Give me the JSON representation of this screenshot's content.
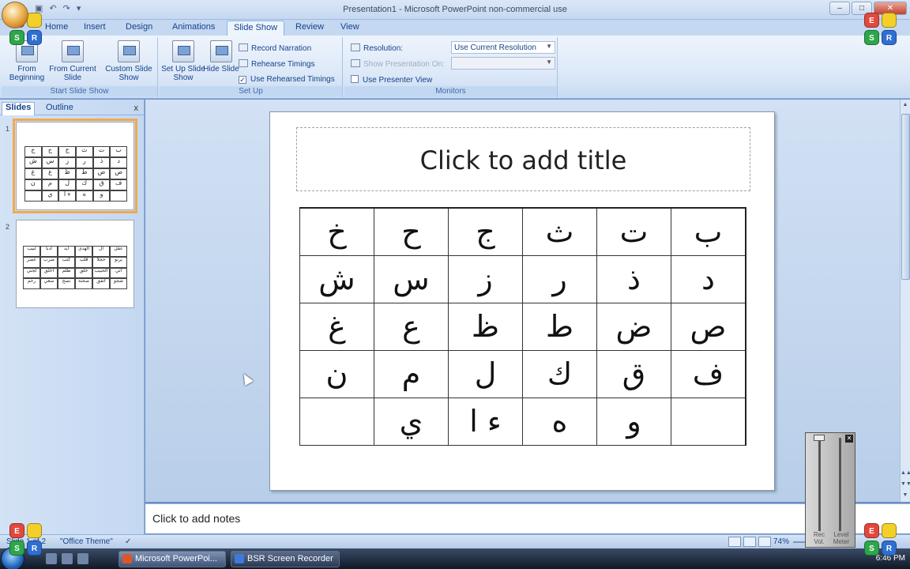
{
  "window": {
    "title": "Presentation1 - Microsoft PowerPoint non-commercial use",
    "controls": [
      "–",
      "□",
      "✕"
    ]
  },
  "tabs": [
    "Home",
    "Insert",
    "Design",
    "Animations",
    "Slide Show",
    "Review",
    "View"
  ],
  "ribbon": {
    "start": {
      "group_label": "Start Slide Show",
      "from_beginning": "From Beginning",
      "from_current": "From Current Slide",
      "custom": "Custom Slide Show"
    },
    "setup": {
      "group_label": "Set Up",
      "setup_show": "Set Up Slide Show",
      "hide_slide": "Hide Slide",
      "record": "Record Narration",
      "rehearse": "Rehearse Timings",
      "use_rehearsed": "Use Rehearsed Timings",
      "use_rehearsed_checked": true
    },
    "monitors": {
      "group_label": "Monitors",
      "resolution_label": "Resolution:",
      "resolution_value": "Use Current Resolution",
      "show_on_label": "Show Presentation On:",
      "presenter_view": "Use Presenter View"
    }
  },
  "left_pane": {
    "tab_slides": "Slides",
    "tab_outline": "Outline",
    "close": "x",
    "thumb1_num": "1",
    "thumb2_num": "2"
  },
  "slide": {
    "title_placeholder": "Click to add title",
    "arabic_letters": [
      "ب",
      "ت",
      "ث",
      "ج",
      "ح",
      "خ",
      "د",
      "ذ",
      "ر",
      "ز",
      "س",
      "ش",
      "ص",
      "ض",
      "ط",
      "ظ",
      "ع",
      "غ",
      "ف",
      "ق",
      "ك",
      "ل",
      "م",
      "ن",
      "",
      "و",
      "ه",
      "ء ا",
      "ي",
      ""
    ],
    "thumb2_words": [
      "عقل",
      "ال",
      "الهدى",
      "ايد",
      "ادباً",
      "لبيب",
      "يرنو",
      "حجلا",
      "قلب",
      "كتب",
      "ضرب",
      "عصر",
      "اتي",
      "الحبيب",
      "خلق",
      "ظلم",
      "اخلق",
      "لجني",
      "شجو",
      "اتفق",
      "صحنة",
      "نصح",
      "سعي",
      "رحم"
    ]
  },
  "notes": {
    "placeholder": "Click to add notes"
  },
  "status": {
    "slide_info": "Slide 1 of 2",
    "theme": "\"Office Theme\"",
    "zoom": "74%"
  },
  "taskbar": {
    "items": [
      "Microsoft PowerPoi...",
      "BSR Screen Recorder"
    ],
    "clock": "6:46 PM"
  },
  "mixer": {
    "rec_label": "Rec Vol.",
    "level_label": "Level Meter"
  },
  "logo": {
    "letters": [
      "E",
      "S",
      "R"
    ]
  }
}
